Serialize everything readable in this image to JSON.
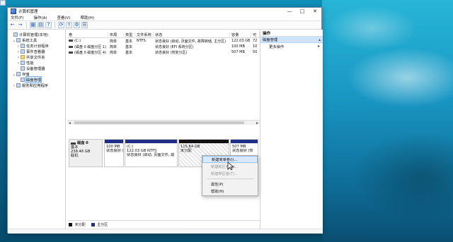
{
  "window": {
    "title": "计算机管理",
    "controls": {
      "minimize": "—",
      "maximize": "□",
      "close": "✕"
    }
  },
  "menubar": [
    "文件(F)",
    "操作(A)",
    "查看(V)",
    "帮助(H)"
  ],
  "toolbar": {
    "icons": [
      "back-arrow-icon",
      "forward-arrow-icon",
      "show-hide-tree-icon",
      "properties-icon",
      "help-icon",
      "refresh-icon",
      "export-list-icon",
      "settings-icon",
      "help-book-icon"
    ]
  },
  "tree": {
    "items": [
      {
        "label": "计算机管理(本地)",
        "indent": 0,
        "expand": "",
        "icon": "computer-icon",
        "selected": false
      },
      {
        "label": "系统工具",
        "indent": 1,
        "expand": "⌄",
        "icon": "tools-icon",
        "selected": false
      },
      {
        "label": "任务计划程序",
        "indent": 2,
        "expand": "›",
        "icon": "calendar-icon",
        "selected": false
      },
      {
        "label": "事件查看器",
        "indent": 2,
        "expand": "›",
        "icon": "event-viewer-icon",
        "selected": false
      },
      {
        "label": "共享文件夹",
        "indent": 2,
        "expand": "›",
        "icon": "folder-icon",
        "selected": false
      },
      {
        "label": "性能",
        "indent": 2,
        "expand": "›",
        "icon": "performance-icon",
        "selected": false
      },
      {
        "label": "设备管理器",
        "indent": 2,
        "expand": "",
        "icon": "device-manager-icon",
        "selected": false
      },
      {
        "label": "存储",
        "indent": 1,
        "expand": "⌄",
        "icon": "storage-icon",
        "selected": false
      },
      {
        "label": "磁盘管理",
        "indent": 2,
        "expand": "",
        "icon": "disk-icon",
        "selected": true
      },
      {
        "label": "服务和应用程序",
        "indent": 1,
        "expand": "›",
        "icon": "services-icon",
        "selected": false
      }
    ]
  },
  "volume_list": {
    "headers": [
      "卷",
      "布局",
      "类型",
      "文件系统",
      "状态",
      "容量",
      "可"
    ],
    "rows": [
      [
        "(C:)",
        "简单",
        "基本",
        "NTFS",
        "状态良好 (启动, 页面文件, 故障转储, 主分区)",
        "122.03 GB",
        "72"
      ],
      [
        "(磁盘 0 磁盘分区 1)",
        "简单",
        "基本",
        "",
        "状态良好 (EFI 系统分区)",
        "100 MB",
        "10"
      ],
      [
        "(磁盘 0 磁盘分区 4)",
        "简单",
        "基本",
        "",
        "状态良好 (恢复分区)",
        "507 MB",
        "50"
      ]
    ]
  },
  "disk_map": {
    "disk": {
      "name": "磁盘 0",
      "type": "基本",
      "size": "238.46 GB",
      "status": "联机"
    },
    "partitions": [
      {
        "kind": "primary",
        "line1": "",
        "line2": "100 MB",
        "line3": "状态良好 (EFI"
      },
      {
        "kind": "primary",
        "line1": "(C:)",
        "line2": "122.03 GB NTFS",
        "line3": "状态良好 (启动, 页面文件, 故"
      },
      {
        "kind": "unallocated",
        "line1": "",
        "line2": "115.84 GB",
        "line3": "未分配"
      },
      {
        "kind": "primary",
        "line1": "",
        "line2": "507 MB",
        "line3": "状态良好 (恢"
      }
    ],
    "legend": [
      {
        "label": "未分配",
        "color": "#111111"
      },
      {
        "label": "主分区",
        "color": "#1f2f86"
      }
    ]
  },
  "actions_pane": {
    "title": "操作",
    "group": "磁盘管理",
    "items": [
      "更多操作"
    ]
  },
  "context_menu": {
    "items": [
      {
        "label": "新建简单卷(I)...",
        "state": "hover"
      },
      {
        "label": "新建跨区卷(N)...",
        "state": "disabled"
      },
      {
        "label": "新建带区卷(T)...",
        "state": "disabled"
      },
      {
        "label": "属性(P)",
        "state": "normal"
      },
      {
        "label": "帮助(H)",
        "state": "normal"
      }
    ]
  }
}
